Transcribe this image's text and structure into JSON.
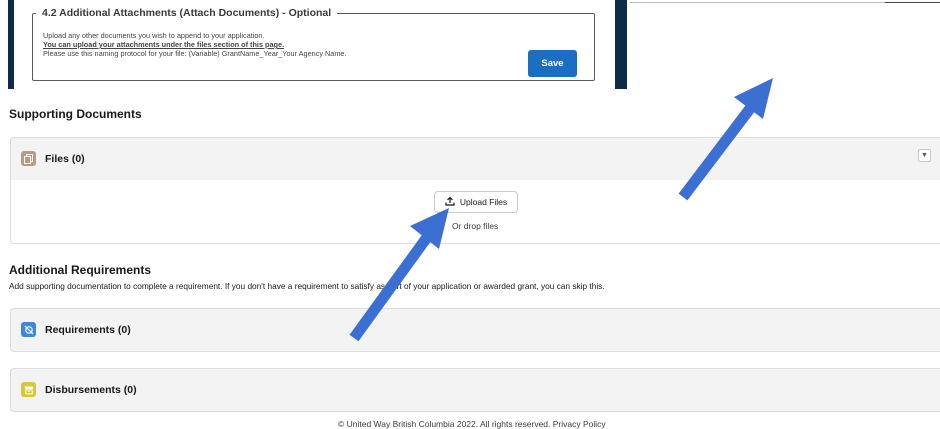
{
  "attachments": {
    "legend": "4.2 Additional Attachments (Attach Documents) - Optional",
    "line1": "Upload any other documents you wish to append to your application.",
    "line2": "You can upload your attachments under the files section of this page.",
    "line3": "Please use this naming protocol for your file: (Variable) GrantName_Year_Your Agency Name.",
    "save_label": "Save"
  },
  "supporting": {
    "title": "Supporting Documents",
    "files_label": "Files (0)",
    "files_icon": "files-icon",
    "upload_label": "Upload Files",
    "drop_text": "Or drop files"
  },
  "additional": {
    "title": "Additional Requirements",
    "description": "Add supporting documentation to complete a requirement. If you don't have a requirement to satisfy as part of your application or awarded grant, you can skip this.",
    "requirements_label": "Requirements (0)",
    "disbursements_label": "Disbursements (0)"
  },
  "footer": {
    "text": "© United Way British Columbia 2022. All rights reserved. Privacy Policy"
  },
  "colors": {
    "accent": "#1b6ec2",
    "arrow": "#3b6fd1",
    "files_icon": "#b89a85",
    "requirements_icon": "#3f87d8",
    "disbursements_icon": "#d7c73a"
  }
}
